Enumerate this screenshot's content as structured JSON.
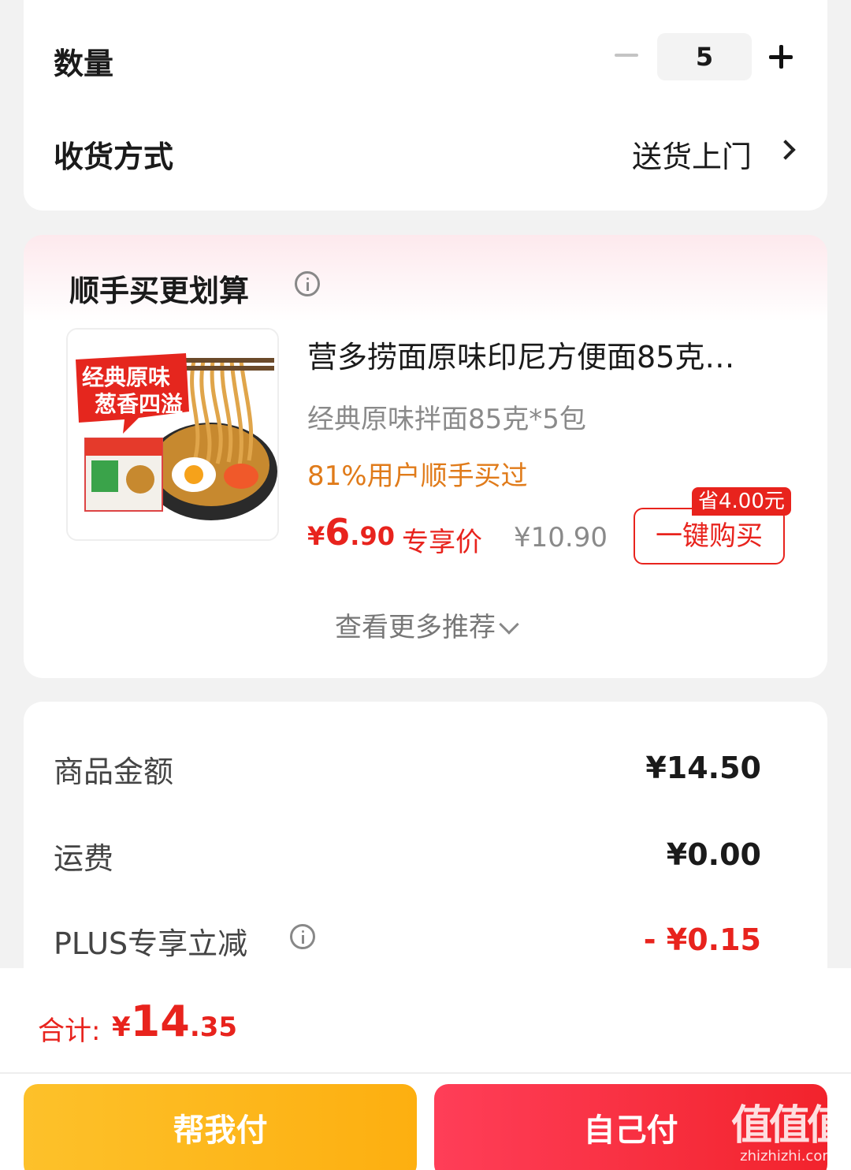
{
  "order": {
    "quantity_label": "数量",
    "quantity_value": "5",
    "delivery_label": "收货方式",
    "delivery_value": "送货上门"
  },
  "recommendation": {
    "title": "顺手买更划算",
    "product": {
      "image_text_line1": "经典原味",
      "image_text_line2": "葱香四溢",
      "name": "营多捞面原味印尼方便面85克…",
      "spec": "经典原味拌面85克*5包",
      "social_proof": "81%用户顺手买过",
      "price_yen": "¥",
      "price_int": "6",
      "price_dec": ".90",
      "price_tag": "专享价",
      "price_old": "¥10.90",
      "save_badge": "省4.00元",
      "buy_button": "一键购买"
    },
    "more_label": "查看更多推荐"
  },
  "amounts": {
    "goods_label": "商品金额",
    "goods_value": "¥14.50",
    "shipping_label": "运费",
    "shipping_value": "¥0.00",
    "plus_label": "PLUS专享立减",
    "plus_value": "- ¥0.15"
  },
  "bottom": {
    "total_label": "合计:",
    "total_yen": "¥",
    "total_int": "14",
    "total_dec": ".35",
    "pay_friend": "帮我付",
    "pay_self": "自己付"
  },
  "watermark": {
    "logo": "值值值",
    "site": "zhizhizhi.com"
  },
  "colors": {
    "accent_red": "#e8231d",
    "social_orange": "#e07b1a",
    "pay_friend_yellow": "#fdb81d",
    "pay_self_red": "#f7303f"
  }
}
